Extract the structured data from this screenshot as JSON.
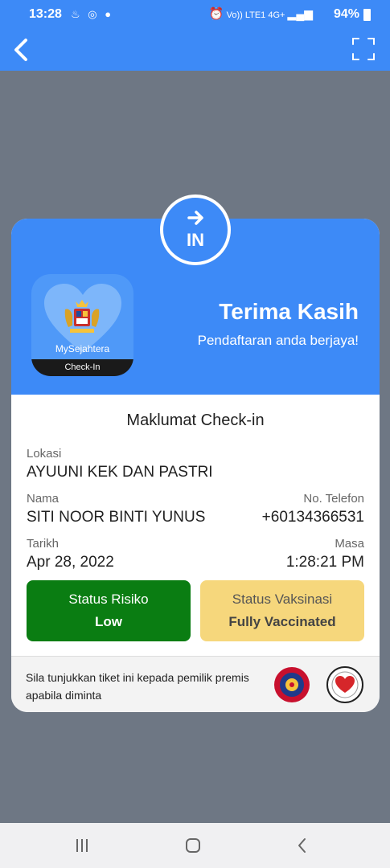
{
  "status_bar": {
    "time": "13:28",
    "left_icons": [
      "notification-icon",
      "whatsapp-icon",
      "facebook-icon"
    ],
    "right_icons": [
      "alarm-icon",
      "volte-icon",
      "4g-icon",
      "signal-icon"
    ],
    "volte_text": "Vo)) LTE1",
    "network_text": "4G+",
    "battery_text": "94%"
  },
  "app_bar": {
    "back_icon": "back-arrow-icon",
    "fullscreen_icon": "fullscreen-icon"
  },
  "card": {
    "badge_text": "IN",
    "app_logo_name": "MySejahtera",
    "app_logo_band": "Check-In",
    "thanks": "Terima Kasih",
    "success_message": "Pendaftaran anda berjaya!",
    "section_title": "Maklumat Check-in",
    "location_label": "Lokasi",
    "location_value": "AYUUNI KEK DAN PASTRI",
    "name_label": "Nama",
    "name_value": "SITI NOOR BINTI YUNUS",
    "phone_label": "No. Telefon",
    "phone_value": "+60134366531",
    "date_label": "Tarikh",
    "date_value": "Apr 28, 2022",
    "time_label": "Masa",
    "time_value": "1:28:21 PM",
    "risk_title": "Status Risiko",
    "risk_value": "Low",
    "vax_title": "Status Vaksinasi",
    "vax_value": "Fully Vaccinated",
    "footer_text": "Sila tunjukkan tiket ini kepada pemilik premis apabila diminta"
  },
  "colors": {
    "primary_blue": "#3d8af7",
    "risk_green": "#0a7d12",
    "vax_yellow": "#f6d77c",
    "background_gray": "#6e7784"
  },
  "nav_bar": {
    "icons": [
      "recent-apps-icon",
      "home-icon",
      "back-icon"
    ]
  }
}
